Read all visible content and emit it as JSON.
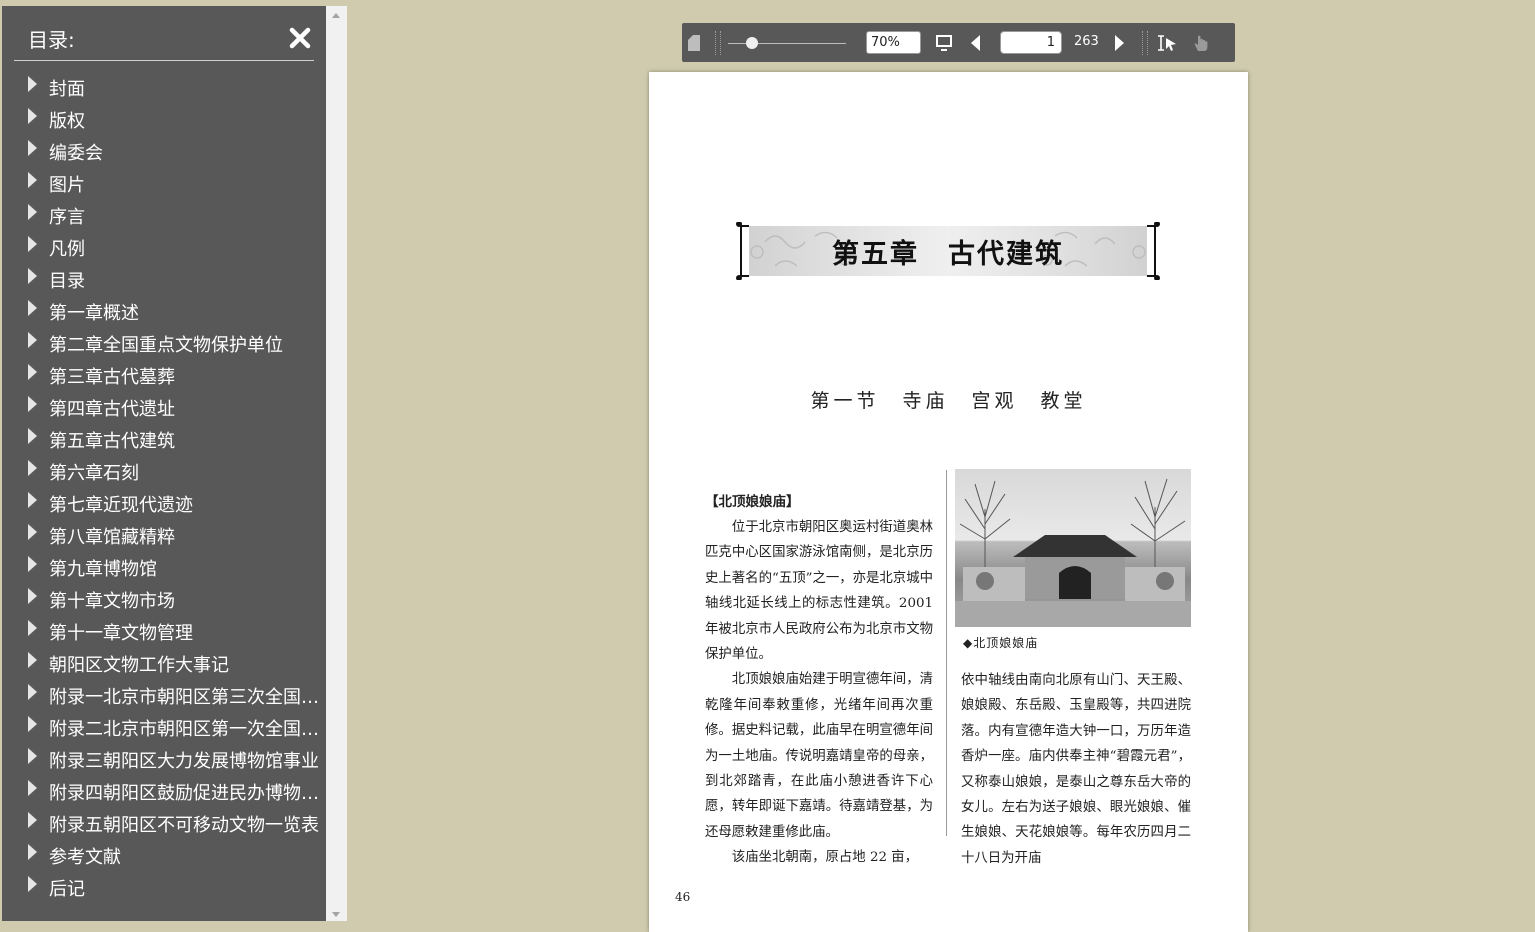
{
  "sidebar": {
    "title": "目录:",
    "close_icon": "close-icon",
    "items": [
      {
        "label": "封面"
      },
      {
        "label": "版权"
      },
      {
        "label": "编委会"
      },
      {
        "label": "图片"
      },
      {
        "label": "序言"
      },
      {
        "label": "凡例"
      },
      {
        "label": "目录"
      },
      {
        "label": "第一章概述"
      },
      {
        "label": "第二章全国重点文物保护单位"
      },
      {
        "label": "第三章古代墓葬"
      },
      {
        "label": "第四章古代遗址"
      },
      {
        "label": "第五章古代建筑"
      },
      {
        "label": "第六章石刻"
      },
      {
        "label": "第七章近现代遗迹"
      },
      {
        "label": "第八章馆藏精粹"
      },
      {
        "label": "第九章博物馆"
      },
      {
        "label": "第十章文物市场"
      },
      {
        "label": "第十一章文物管理"
      },
      {
        "label": "朝阳区文物工作大事记"
      },
      {
        "label": "附录一北京市朝阳区第三次全国文物普查"
      },
      {
        "label": "附录二北京市朝阳区第一次全国可移动文物普查"
      },
      {
        "label": "附录三朝阳区大力发展博物馆事业"
      },
      {
        "label": "附录四朝阳区鼓励促进民办博物馆发展"
      },
      {
        "label": "附录五朝阳区不可移动文物一览表"
      },
      {
        "label": "参考文献"
      },
      {
        "label": "后记"
      }
    ]
  },
  "toolbar": {
    "zoom_value": "70%",
    "zoom_fraction": 0.2,
    "current_page": "1",
    "total_pages": "263",
    "icons": [
      "thumbnails-icon",
      "fit-page-icon",
      "prev-page-icon",
      "next-page-icon",
      "text-select-icon",
      "hand-tool-icon"
    ]
  },
  "page": {
    "chapter_title": "第五章　古代建筑",
    "section_title": "第一节　寺庙　宫观　教堂",
    "entry_title": "【北顶娘娘庙】",
    "left_paragraphs": [
      "位于北京市朝阳区奥运村街道奥林匹克中心区国家游泳馆南侧，是北京历史上著名的“五顶”之一，亦是北京城中轴线北延长线上的标志性建筑。2001 年被北京市人民政府公布为北京市文物保护单位。",
      "北顶娘娘庙始建于明宣德年间，清乾隆年间奉敕重修，光绪年间再次重修。据史料记载，此庙早在明宣德年间为一土地庙。传说明嘉靖皇帝的母亲，到北郊踏青，在此庙小憩进香许下心愿，转年即诞下嘉靖。待嘉靖登基，为还母愿敕建重修此庙。",
      "该庙坐北朝南，原占地 22 亩，"
    ],
    "photo_caption": "◆北顶娘娘庙",
    "right_paragraph": "依中轴线由南向北原有山门、天王殿、娘娘殿、东岳殿、玉皇殿等，共四进院落。内有宣德年造大钟一口，万历年造香炉一座。庙内供奉主神“碧霞元君”，又称泰山娘娘，是泰山之尊东岳大帝的女儿。左右为送子娘娘、眼光娘娘、催生娘娘、天花娘娘等。每年农历四月二十八日为开庙",
    "page_number": "46"
  }
}
